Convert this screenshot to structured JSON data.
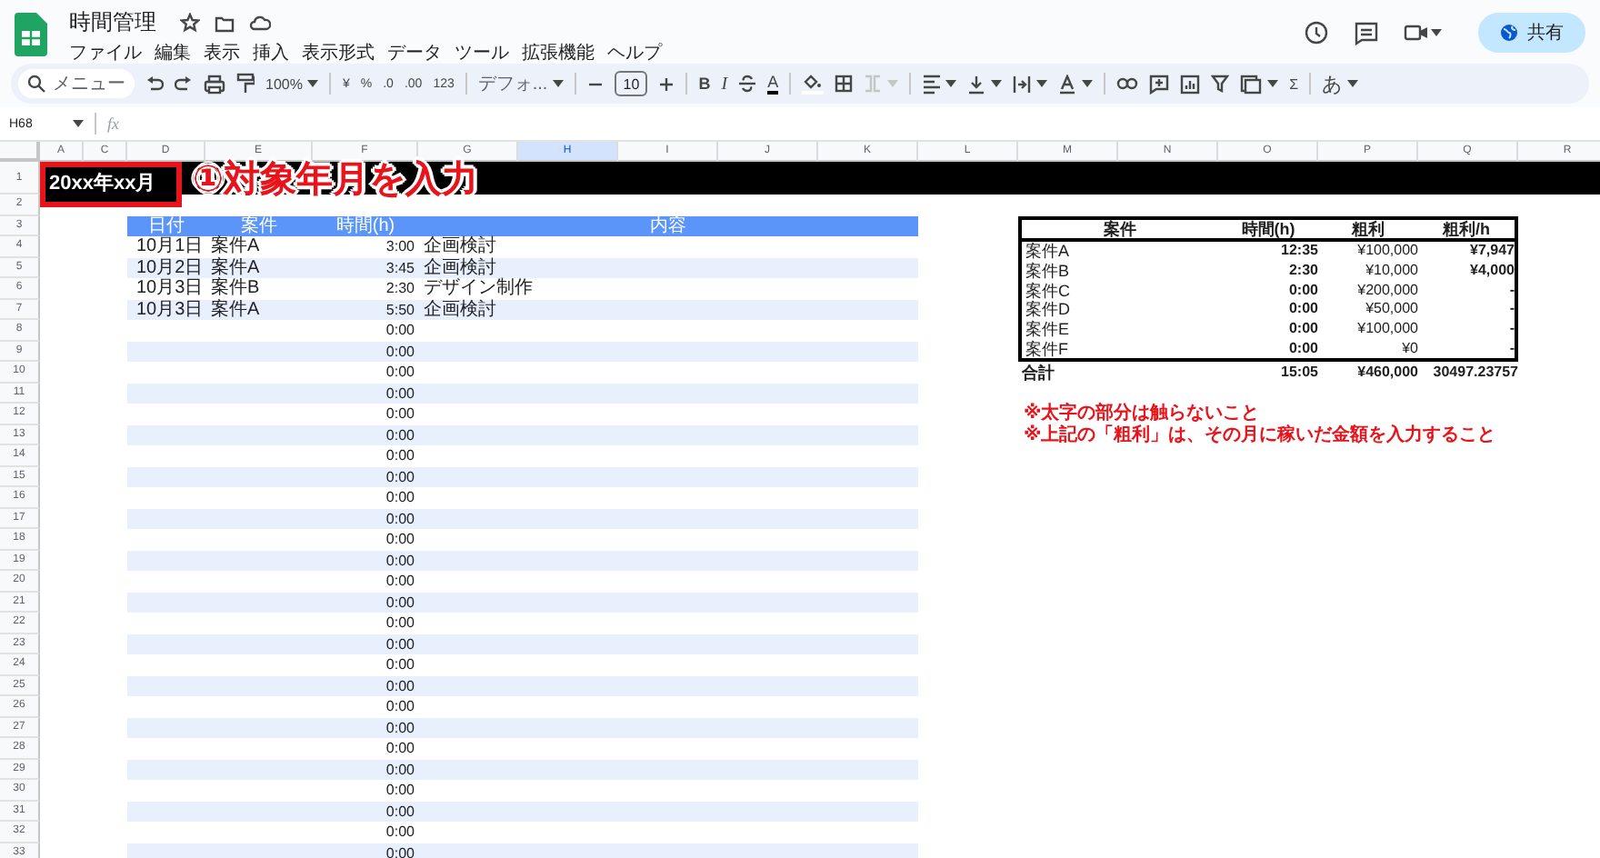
{
  "app": {
    "title": "時間管理",
    "menu": [
      "ファイル",
      "編集",
      "表示",
      "挿入",
      "表示形式",
      "データ",
      "ツール",
      "拡張機能",
      "ヘルプ"
    ],
    "share_button": "共有"
  },
  "toolbar": {
    "search_placeholder": "メニュー",
    "zoom": "100%",
    "currency": "¥",
    "percent": "%",
    "decrease_decimal": ".0",
    "increase_decimal": ".00",
    "number_format": "123",
    "font": "デフォ...",
    "font_size": "10",
    "bold": "B",
    "italic": "I",
    "text_color": "A",
    "function": "Σ",
    "input_tools": "あ"
  },
  "formula_bar": {
    "cell_ref": "H68",
    "fx": "fx"
  },
  "columns": [
    {
      "label": "A",
      "selected": false
    },
    {
      "label": "C",
      "selected": false
    },
    {
      "label": "D",
      "selected": false
    },
    {
      "label": "E",
      "selected": false
    },
    {
      "label": "F",
      "selected": false
    },
    {
      "label": "G",
      "selected": false
    },
    {
      "label": "H",
      "selected": true
    },
    {
      "label": "I",
      "selected": false
    },
    {
      "label": "J",
      "selected": false
    },
    {
      "label": "K",
      "selected": false
    },
    {
      "label": "L",
      "selected": false
    },
    {
      "label": "M",
      "selected": false
    },
    {
      "label": "N",
      "selected": false
    },
    {
      "label": "O",
      "selected": false
    },
    {
      "label": "P",
      "selected": false
    },
    {
      "label": "Q",
      "selected": false
    },
    {
      "label": "R",
      "selected": false
    }
  ],
  "row_numbers": [
    "1",
    "2",
    "3",
    "4",
    "5",
    "6",
    "7",
    "8",
    "9",
    "10",
    "11",
    "12",
    "13",
    "14",
    "15",
    "16",
    "17",
    "18",
    "19",
    "20",
    "21",
    "22",
    "23",
    "24",
    "25",
    "26",
    "27",
    "28",
    "29",
    "30",
    "31",
    "32",
    "33"
  ],
  "month_cell": "20xx年xx月",
  "annotation": "①対象年月を入力",
  "log_table": {
    "columns": [
      "日付",
      "案件",
      "時間(h)",
      "内容"
    ],
    "rows": [
      {
        "date": "10月1日",
        "project": "案件A",
        "hours": "3:00",
        "content": "企画検討"
      },
      {
        "date": "10月2日",
        "project": "案件A",
        "hours": "3:45",
        "content": "企画検討"
      },
      {
        "date": "10月3日",
        "project": "案件B",
        "hours": "2:30",
        "content": "デザイン制作"
      },
      {
        "date": "10月3日",
        "project": "案件A",
        "hours": "5:50",
        "content": "企画検討"
      },
      {
        "hours": "0:00"
      },
      {
        "hours": "0:00"
      },
      {
        "hours": "0:00"
      },
      {
        "hours": "0:00"
      },
      {
        "hours": "0:00"
      },
      {
        "hours": "0:00"
      },
      {
        "hours": "0:00"
      },
      {
        "hours": "0:00"
      },
      {
        "hours": "0:00"
      },
      {
        "hours": "0:00"
      },
      {
        "hours": "0:00"
      },
      {
        "hours": "0:00"
      },
      {
        "hours": "0:00"
      },
      {
        "hours": "0:00"
      },
      {
        "hours": "0:00"
      },
      {
        "hours": "0:00"
      },
      {
        "hours": "0:00"
      },
      {
        "hours": "0:00"
      },
      {
        "hours": "0:00"
      },
      {
        "hours": "0:00"
      },
      {
        "hours": "0:00"
      },
      {
        "hours": "0:00"
      },
      {
        "hours": "0:00"
      },
      {
        "hours": "0:00"
      },
      {
        "hours": "0:00"
      },
      {
        "hours": "0:00"
      }
    ]
  },
  "summary_table": {
    "columns": [
      "案件",
      "時間(h)",
      "粗利",
      "粗利/h"
    ],
    "rows": [
      {
        "project": "案件A",
        "hours": "12:35",
        "profit": "¥100,000",
        "per_hour": "¥7,947"
      },
      {
        "project": "案件B",
        "hours": "2:30",
        "profit": "¥10,000",
        "per_hour": "¥4,000"
      },
      {
        "project": "案件C",
        "hours": "0:00",
        "profit": "¥200,000",
        "per_hour": "-"
      },
      {
        "project": "案件D",
        "hours": "0:00",
        "profit": "¥50,000",
        "per_hour": "-"
      },
      {
        "project": "案件E",
        "hours": "0:00",
        "profit": "¥100,000",
        "per_hour": "-"
      },
      {
        "project": "案件F",
        "hours": "0:00",
        "profit": "¥0",
        "per_hour": "-"
      }
    ],
    "total": {
      "label": "合計",
      "hours": "15:05",
      "profit": "¥460,000",
      "per_hour": "30497.23757"
    }
  },
  "notes": [
    "※太字の部分は触らないこと",
    "※上記の「粗利」は、その月に稼いだ金額を入力すること"
  ]
}
